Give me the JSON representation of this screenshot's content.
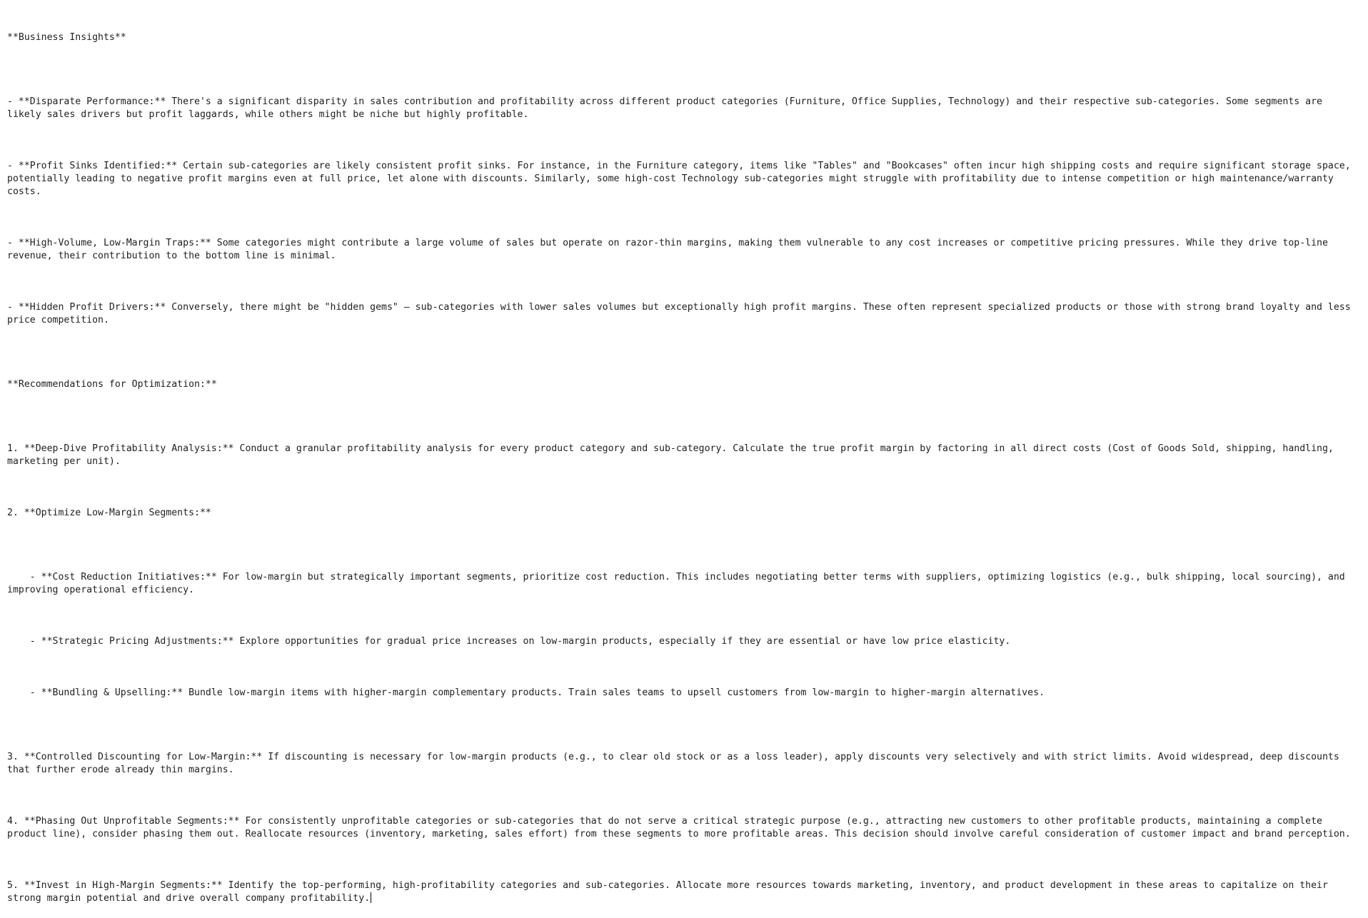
{
  "document": {
    "heading_insights": "**Business Insights**",
    "insights": [
      "- **Disparate Performance:** There's a significant disparity in sales contribution and profitability across different product categories (Furniture, Office Supplies, Technology) and their respective sub-categories. Some segments are likely sales drivers but profit laggards, while others might be niche but highly profitable.",
      "- **Profit Sinks Identified:** Certain sub-categories are likely consistent profit sinks. For instance, in the Furniture category, items like \"Tables\" and \"Bookcases\" often incur high shipping costs and require significant storage space, potentially leading to negative profit margins even at full price, let alone with discounts. Similarly, some high-cost Technology sub-categories might struggle with profitability due to intense competition or high maintenance/warranty costs.",
      "- **High-Volume, Low-Margin Traps:** Some categories might contribute a large volume of sales but operate on razor-thin margins, making them vulnerable to any cost increases or competitive pricing pressures. While they drive top-line revenue, their contribution to the bottom line is minimal.",
      "- **Hidden Profit Drivers:** Conversely, there might be \"hidden gems\" – sub-categories with lower sales volumes but exceptionally high profit margins. These often represent specialized products or those with strong brand loyalty and less price competition."
    ],
    "heading_recommendations": "**Recommendations for Optimization:**",
    "rec_1": "1. **Deep-Dive Profitability Analysis:** Conduct a granular profitability analysis for every product category and sub-category. Calculate the true profit margin by factoring in all direct costs (Cost of Goods Sold, shipping, handling, marketing per unit).",
    "rec_2": "2. **Optimize Low-Margin Segments:**",
    "rec_2_sub": [
      "- **Cost Reduction Initiatives:** For low-margin but strategically important segments, prioritize cost reduction. This includes negotiating better terms with suppliers, optimizing logistics (e.g., bulk shipping, local sourcing), and improving operational efficiency.",
      "- **Strategic Pricing Adjustments:** Explore opportunities for gradual price increases on low-margin products, especially if they are essential or have low price elasticity.",
      "- **Bundling & Upselling:** Bundle low-margin items with higher-margin complementary products. Train sales teams to upsell customers from low-margin to higher-margin alternatives."
    ],
    "rec_3": "3. **Controlled Discounting for Low-Margin:** If discounting is necessary for low-margin products (e.g., to clear old stock or as a loss leader), apply discounts very selectively and with strict limits. Avoid widespread, deep discounts that further erode already thin margins.",
    "rec_4": "4. **Phasing Out Unprofitable Segments:** For consistently unprofitable categories or sub-categories that do not serve a critical strategic purpose (e.g., attracting new customers to other profitable products, maintaining a complete product line), consider phasing them out. Reallocate resources (inventory, marketing, sales effort) from these segments to more profitable areas. This decision should involve careful consideration of customer impact and brand perception.",
    "rec_5": "5. **Invest in High-Margin Segments:** Identify the top-performing, high-profitability categories and sub-categories. Allocate more resources towards marketing, inventory, and product development in these areas to capitalize on their strong margin potential and drive overall company profitability."
  }
}
